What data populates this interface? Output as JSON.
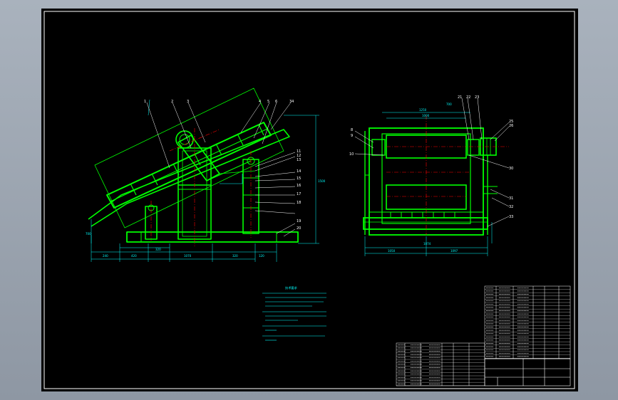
{
  "drawing": {
    "colors": {
      "background": "#000000",
      "frame": "#ffffff",
      "part_outline": "#00ff00",
      "dimension": "#00ffff",
      "center_line": "#ff0000",
      "leader": "#ffffff"
    },
    "side_view": {
      "part_numbers_top": [
        "1",
        "2",
        "3",
        "4",
        "5",
        "6",
        "34"
      ],
      "part_numbers_right": [
        "11",
        "12",
        "13",
        "14",
        "15",
        "16",
        "17",
        "18",
        "19",
        "20"
      ]
    },
    "end_view": {
      "part_numbers_left": [
        "8",
        "9",
        "10"
      ],
      "part_numbers_top": [
        "21",
        "22",
        "23"
      ],
      "part_numbers_right": [
        "25",
        "26",
        "30",
        "31",
        "32",
        "33"
      ]
    },
    "technical_notes": {
      "title": "技术要求"
    }
  }
}
